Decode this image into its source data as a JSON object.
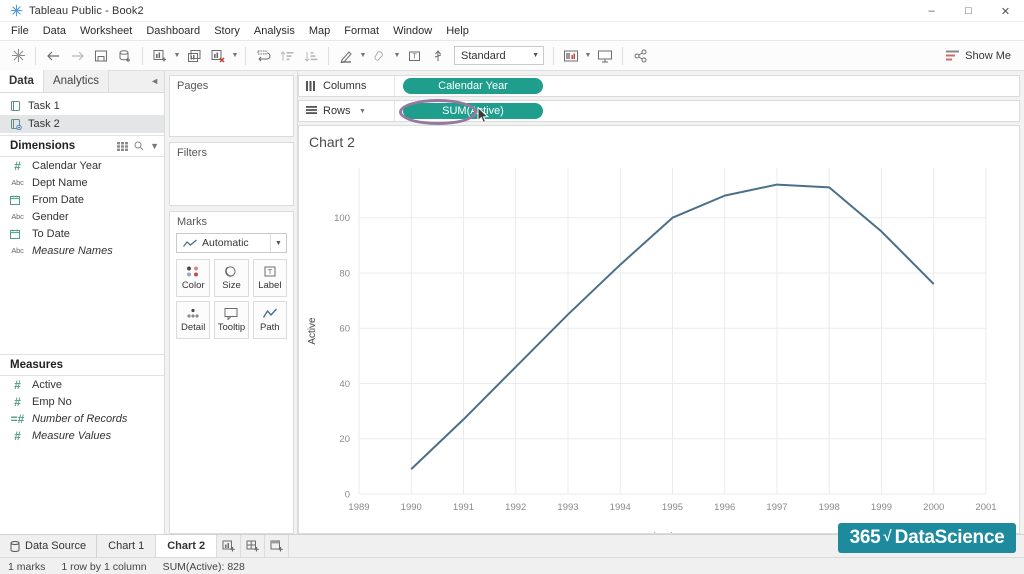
{
  "window": {
    "title": "Tableau Public - Book2",
    "app_icon": "tableau-logo-icon",
    "controls": {
      "minimize": "minimize-icon",
      "maximize": "maximize-icon",
      "close": "close-icon"
    }
  },
  "menu": {
    "items": [
      "File",
      "Data",
      "Worksheet",
      "Dashboard",
      "Story",
      "Analysis",
      "Map",
      "Format",
      "Window",
      "Help"
    ]
  },
  "toolbar": {
    "fit_value": "Standard",
    "show_me_label": "Show Me",
    "buttons": [
      "tableau-home-icon",
      "undo-icon",
      "redo-icon",
      "save-icon",
      "add-data-source-icon",
      "new-worksheet-icon",
      "duplicate-sheet-icon",
      "clear-sheet-icon",
      "swap-rows-cols-icon",
      "sort-ascending-icon",
      "sort-descending-icon",
      "highlight-icon",
      "group-icon",
      "show-labels-icon",
      "fix-axes-icon",
      "presentation-mode-icon",
      "share-icon",
      "show-me-icon"
    ]
  },
  "data_pane": {
    "tabs": [
      {
        "label": "Data",
        "active": true
      },
      {
        "label": "Analytics",
        "active": false
      }
    ],
    "collapse_icon": "collapse-pane-icon",
    "data_sources": [
      {
        "label": "Task 1",
        "icon": "data-source-icon",
        "selected": false
      },
      {
        "label": "Task 2",
        "icon": "data-source-live-icon",
        "selected": true
      }
    ],
    "dimensions": {
      "header": "Dimensions",
      "tools": [
        "grid-view-icon",
        "search-icon",
        "chevron-down-icon"
      ],
      "fields": [
        {
          "label": "Calendar Year",
          "type": "#",
          "italic": false
        },
        {
          "label": "Dept Name",
          "type": "Abc",
          "italic": false
        },
        {
          "label": "From Date",
          "type": "calendar",
          "italic": false
        },
        {
          "label": "Gender",
          "type": "Abc",
          "italic": false
        },
        {
          "label": "To Date",
          "type": "calendar",
          "italic": false
        },
        {
          "label": "Measure Names",
          "type": "Abc",
          "italic": true
        }
      ]
    },
    "measures": {
      "header": "Measures",
      "fields": [
        {
          "label": "Active",
          "type": "#",
          "italic": false
        },
        {
          "label": "Emp No",
          "type": "#",
          "italic": false
        },
        {
          "label": "Number of Records",
          "type": "#",
          "italic": true
        },
        {
          "label": "Measure Values",
          "type": "#",
          "italic": true
        }
      ]
    }
  },
  "cards": {
    "pages_title": "Pages",
    "filters_title": "Filters",
    "marks_title": "Marks",
    "mark_type": "Automatic",
    "mark_type_icon": "line-mark-icon",
    "mark_buttons": [
      {
        "label": "Color",
        "icon": "color-icon"
      },
      {
        "label": "Size",
        "icon": "size-icon"
      },
      {
        "label": "Label",
        "icon": "label-icon"
      },
      {
        "label": "Detail",
        "icon": "detail-icon"
      },
      {
        "label": "Tooltip",
        "icon": "tooltip-icon"
      },
      {
        "label": "Path",
        "icon": "path-icon"
      }
    ]
  },
  "shelves": {
    "columns_label": "Columns",
    "columns_icon": "columns-shelf-icon",
    "columns_pill": "Calendar Year",
    "rows_label": "Rows",
    "rows_icon": "rows-shelf-icon",
    "rows_pill": "SUM(Active)",
    "annotation_color": "#97799f",
    "pill_color": "#1f9e8e"
  },
  "worksheet": {
    "title": "Chart 2"
  },
  "bottom_bar": {
    "data_source_label": "Data Source",
    "data_source_icon": "data-source-tab-icon",
    "tabs": [
      {
        "label": "Chart 1",
        "active": false
      },
      {
        "label": "Chart 2",
        "active": true
      }
    ],
    "new_buttons": [
      "new-worksheet-icon",
      "new-dashboard-icon",
      "new-story-icon"
    ]
  },
  "status_bar": {
    "marks": "1 marks",
    "rows_cols": "1 row by 1 column",
    "aggregate": "SUM(Active): 828"
  },
  "watermark": {
    "part1": "365",
    "radical": "√",
    "part2": "DataScience",
    "background": "#1d8a9e"
  },
  "chart_data": {
    "type": "line",
    "title": "Chart 2",
    "xlabel": "Calendar Year",
    "ylabel": "Active",
    "line_color": "#4a6f8a",
    "grid": true,
    "xlim": [
      1989,
      2001
    ],
    "ylim": [
      0,
      118
    ],
    "yticks": [
      0,
      20,
      40,
      60,
      80,
      100
    ],
    "xticks": [
      1989,
      1990,
      1991,
      1992,
      1993,
      1994,
      1995,
      1996,
      1997,
      1998,
      1999,
      2000,
      2001
    ],
    "x": [
      1990,
      1991,
      1992,
      1993,
      1994,
      1995,
      1996,
      1997,
      1998,
      1999,
      2000
    ],
    "values": [
      9,
      27,
      46,
      65,
      83,
      100,
      108,
      112,
      111,
      95,
      76
    ],
    "series": [
      {
        "name": "Active",
        "values": [
          9,
          27,
          46,
          65,
          83,
          100,
          108,
          112,
          111,
          95,
          76
        ]
      }
    ]
  }
}
